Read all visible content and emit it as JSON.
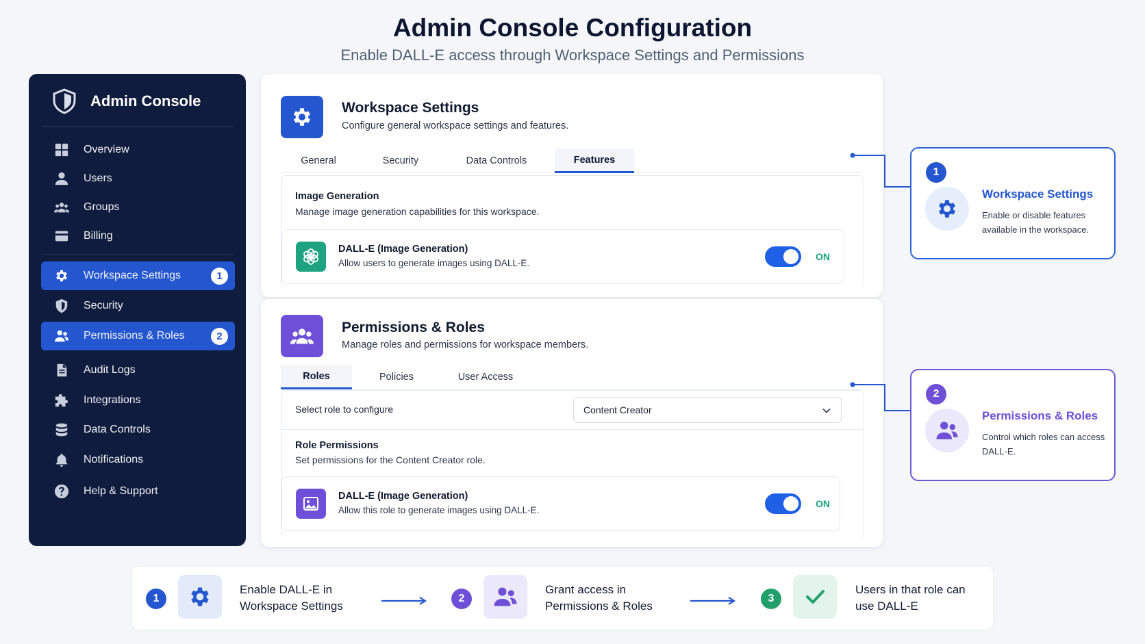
{
  "header": {
    "title": "Admin Console Configuration",
    "subtitle": "Enable DALL-E access through Workspace Settings and Permissions"
  },
  "sidebar": {
    "brand": "Admin Console",
    "items": [
      {
        "label": "Overview",
        "icon": "grid-icon"
      },
      {
        "label": "Users",
        "icon": "user-icon"
      },
      {
        "label": "Groups",
        "icon": "group-icon"
      },
      {
        "label": "Billing",
        "icon": "card-icon"
      },
      {
        "label": "Workspace Settings",
        "icon": "gear-icon",
        "active": true,
        "badge": "1"
      },
      {
        "label": "Security",
        "icon": "shield-icon"
      },
      {
        "label": "Permissions & Roles",
        "icon": "users-icon",
        "active": true,
        "badge": "2"
      },
      {
        "label": "Audit Logs",
        "icon": "document-icon"
      },
      {
        "label": "Integrations",
        "icon": "puzzle-icon"
      },
      {
        "label": "Data Controls",
        "icon": "database-icon"
      },
      {
        "label": "Notifications",
        "icon": "bell-icon"
      },
      {
        "label": "Help & Support",
        "icon": "help-icon"
      }
    ]
  },
  "workspace": {
    "title": "Workspace Settings",
    "description": "Configure general workspace settings and features.",
    "tabs": [
      "General",
      "Security",
      "Data Controls",
      "Features"
    ],
    "active_tab": "Features",
    "section_title": "Image Generation",
    "section_desc": "Manage image generation capabilities for this workspace.",
    "feature": {
      "title": "DALL-E (Image Generation)",
      "desc": "Allow users to generate images using DALL-E.",
      "state": "ON"
    }
  },
  "permissions": {
    "title": "Permissions & Roles",
    "description": "Manage roles and permissions for workspace members.",
    "tabs": [
      "Roles",
      "Policies",
      "User Access"
    ],
    "active_tab": "Roles",
    "select_label": "Select role to configure",
    "select_value": "Content Creator",
    "section_title": "Role Permissions",
    "section_desc": "Set permissions for the Content Creator role.",
    "feature": {
      "title": "DALL-E (Image Generation)",
      "desc": "Allow this role to generate images using DALL-E.",
      "state": "ON"
    }
  },
  "callouts": [
    {
      "num": "1",
      "title": "Workspace Settings",
      "desc": "Enable or disable features available in the workspace."
    },
    {
      "num": "2",
      "title": "Permissions & Roles",
      "desc": "Control which roles can access DALL-E."
    }
  ],
  "flow": [
    {
      "num": "1",
      "text": "Enable DALL-E in Workspace Settings"
    },
    {
      "num": "2",
      "text": "Grant access in Permissions & Roles"
    },
    {
      "num": "3",
      "text": "Users in that role can use DALL-E"
    }
  ],
  "colors": {
    "sidebar_bg": "#0f1c3d",
    "accent_blue": "#2456cf",
    "accent_purple": "#6d58d6",
    "toggle_on": "#2060e6",
    "on_text": "#13a37d",
    "success_green": "#22a06b"
  }
}
